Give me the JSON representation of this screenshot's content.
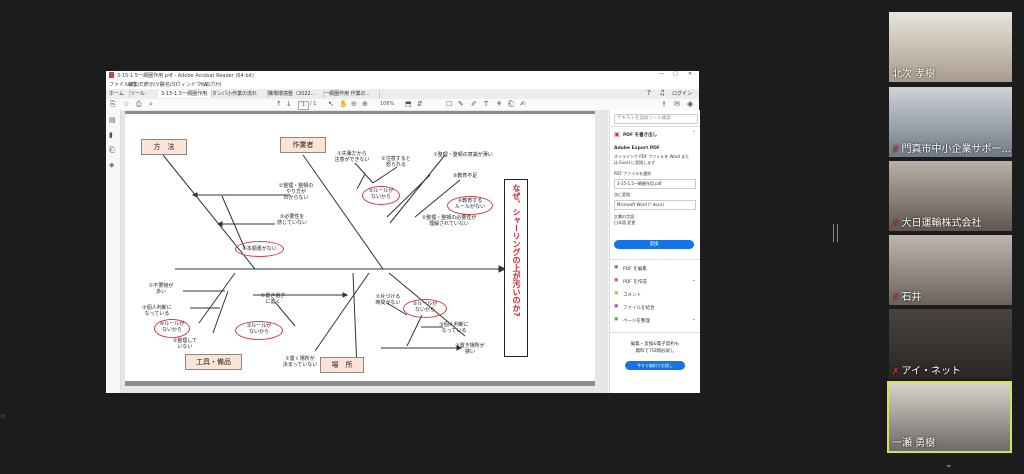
{
  "window": {
    "title": "3-15-1.5一網圏作用.pdf - Adobe Acrobat Reader (64-bit)",
    "menu": [
      "ファイル(F)",
      "編集(E)",
      "表示(V)",
      "署名(S)",
      "ウィンドウ(W)",
      "ヘルプ(H)"
    ],
    "login": "ログイン"
  },
  "tabs": [
    "ホーム",
    "ツール",
    "3-15-1.5一網圏作用.",
    "タンパ小作業の流れ",
    "職場環境整（2022...",
    "一網圏作用 作業の..."
  ],
  "toolbar": {
    "page_num": "1",
    "page_total": "/ 1",
    "zoom": "106%"
  },
  "diagram": {
    "categories": {
      "method": "方　法",
      "worker": "作業者",
      "tools": "工具・備品",
      "place": "場　所"
    },
    "effect": "なぜ、シャーリングの上が汚いのか?",
    "causes": {
      "m1": "①整理・整頓の\nやり方が\nわからない",
      "m2": "③必要性を\n感じていない",
      "m3": "②本順書がない",
      "w1": "①先輩だから\n注意ができない",
      "w2": "②注意すると\n怒られる",
      "w3": "①整理・整頓の意識が薄い",
      "w4": "③教育不足",
      "w5": "②ルールが\nないから",
      "w6": "④教育する\nルールがない",
      "w7": "②整理・整頓の必要性が\n理解されていない",
      "t1": "①不要物が\n多い",
      "t2": "②個人判断に\nなっている",
      "t3": "④ルールが\nないから",
      "t4": "②整理して\nいない",
      "t5": "①置き過ぎ\nに置く",
      "t6": "③ルールが\nないから",
      "p1": "②片づける\n時間がない",
      "p2": "②ルールが\nないから",
      "p3": "③個人判断に\nなっている",
      "p4": "①置く場所が\n決まっていない",
      "p5": "③置き場所が\n狭い"
    }
  },
  "right_panel": {
    "search": "テキストを追加ツール検索",
    "export_title": "PDF を書き出し",
    "export_heading": "Adobe Export PDF",
    "export_desc": "オンラインで PDF ファイルを Word または Excel に変換します",
    "file_label": "PDF ファイルを選択",
    "file_name": "3-15-1.5一網圏作用.pdf",
    "convert_label": "次に変換：",
    "convert_value": "Microsoft Word (*.docx)",
    "lang_label": "文書の言語：",
    "lang_value": "日本語 変更",
    "convert_button": "変換",
    "tools": [
      "PDF を編集",
      "PDF を作成",
      "コメント",
      "ファイルを結合",
      "ページを整理"
    ],
    "promo": "編集・変換&電子契約も\n無料で7日間お試し",
    "promo_button": "今すぐ無料でお試し"
  },
  "participants": [
    {
      "name": "北次 孝樹"
    },
    {
      "name": "門真市中小企業サポー..."
    },
    {
      "name": "大日運輸株式会社"
    },
    {
      "name": "石井"
    },
    {
      "name": "アイ・ネット"
    },
    {
      "name": "一瀬 勇樹"
    }
  ],
  "colors": {
    "accent": "#1473e6",
    "effect_text": "#d4202a",
    "active_speaker": "#d8e05a"
  }
}
